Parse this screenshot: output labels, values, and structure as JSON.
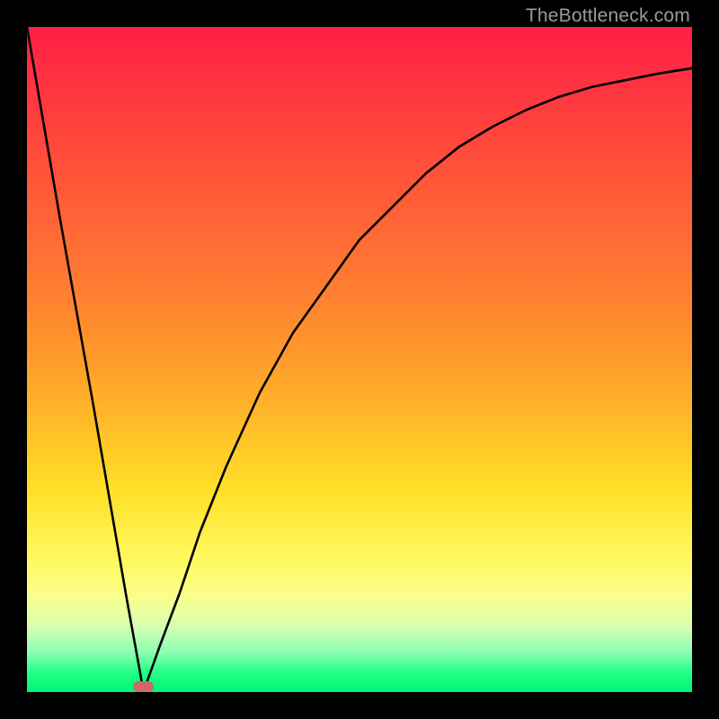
{
  "watermark": "TheBottleneck.com",
  "chart_data": {
    "type": "line",
    "title": "",
    "xlabel": "",
    "ylabel": "",
    "xlim": [
      0,
      100
    ],
    "ylim": [
      0,
      100
    ],
    "grid": false,
    "legend": null,
    "series": [
      {
        "name": "bottleneck-curve",
        "x": [
          0,
          5,
          10,
          15,
          17,
          17.5,
          20,
          23,
          26,
          30,
          35,
          40,
          45,
          50,
          55,
          60,
          65,
          70,
          75,
          80,
          85,
          90,
          95,
          100
        ],
        "y": [
          100,
          71,
          43,
          14,
          3,
          0,
          7,
          15,
          24,
          34,
          45,
          54,
          61,
          68,
          73,
          78,
          82,
          85,
          87.5,
          89.5,
          91,
          92,
          93,
          93.8
        ]
      }
    ],
    "marker": {
      "name": "optimal-range",
      "x_start": 16,
      "x_end": 19,
      "y": 0,
      "color": "#cc6b66"
    },
    "background_gradient": {
      "top": "#ff1f45",
      "middle": "#ffe028",
      "bottom": "#00f37b"
    }
  }
}
